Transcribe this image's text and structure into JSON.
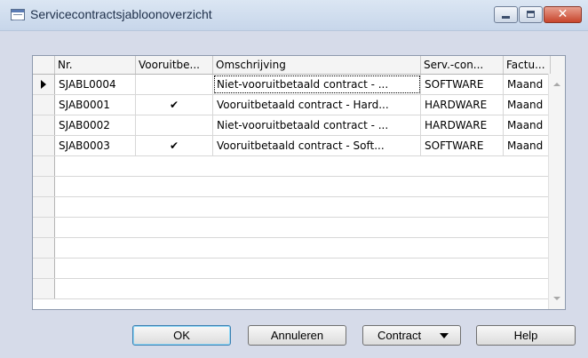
{
  "window": {
    "title": "Servicecontractsjabloonoverzicht",
    "controls": {
      "minimize": "minimize-icon",
      "maximize": "maximize-icon",
      "close": "✕"
    }
  },
  "table": {
    "columns": [
      "Nr.",
      "Vooruitbe...",
      "Omschrijving",
      "Serv.-con...",
      "Factu..."
    ],
    "rows": [
      {
        "nr": "SJABL0004",
        "prepaid": "",
        "description": "Niet-vooruitbetaald contract - ...",
        "service": "SOFTWARE",
        "invoice": "Maand",
        "current": true
      },
      {
        "nr": "SJAB0001",
        "prepaid": "✔",
        "description": "Vooruitbetaald contract - Hard...",
        "service": "HARDWARE",
        "invoice": "Maand"
      },
      {
        "nr": "SJAB0002",
        "prepaid": "",
        "description": "Niet-vooruitbetaald contract - ...",
        "service": "HARDWARE",
        "invoice": "Maand"
      },
      {
        "nr": "SJAB0003",
        "prepaid": "✔",
        "description": "Vooruitbetaald contract - Soft...",
        "service": "SOFTWARE",
        "invoice": "Maand"
      }
    ]
  },
  "buttons": {
    "ok": "OK",
    "cancel": "Annuleren",
    "contract": "Contract",
    "help": "Help"
  },
  "colors": {
    "window_background": "#d6dbe9",
    "titlebar_text": "#1e2f4a",
    "close_button": "#c8452c",
    "default_button_outline": "#3c7fb1"
  }
}
